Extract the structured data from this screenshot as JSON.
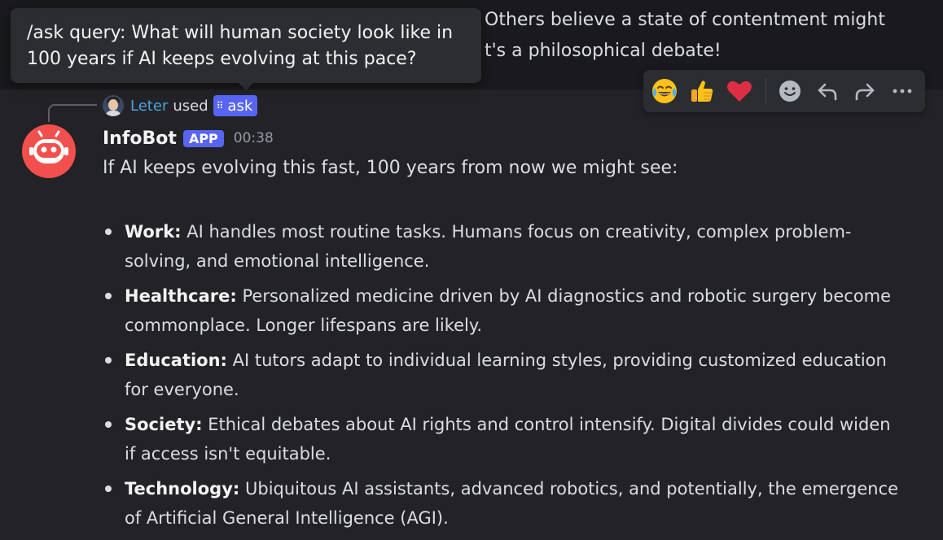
{
  "previous_message": {
    "line1": "Others believe a state of contentment might",
    "line2": "t's a philosophical debate!"
  },
  "tooltip": {
    "text": "/ask query: What will human society look like in 100 years if AI keeps evolving at this pace?"
  },
  "command_usage": {
    "username": "Leter",
    "used_text": "used",
    "command_label": "ask",
    "command_icon": "slash-command-icon"
  },
  "message": {
    "author": "InfoBot",
    "badge": "APP",
    "timestamp": "00:38",
    "intro": "If AI keeps evolving this fast, 100 years from now we might see:",
    "items": [
      {
        "term": "Work:",
        "text": "AI handles most routine tasks. Humans focus on creativity, complex problem-solving, and emotional intelligence."
      },
      {
        "term": "Healthcare:",
        "text": "Personalized medicine driven by AI diagnostics and robotic surgery become commonplace. Longer lifespans are likely."
      },
      {
        "term": "Education:",
        "text": "AI tutors adapt to individual learning styles, providing customized education for everyone."
      },
      {
        "term": "Society:",
        "text": "Ethical debates about AI rights and control intensify. Digital divides could widen if access isn't equitable."
      },
      {
        "term": "Technology:",
        "text": "Ubiquitous AI assistants, advanced robotics, and potentially, the emergence of Artificial General Intelligence (AGI)."
      }
    ]
  },
  "actions": [
    {
      "name": "joy-reaction",
      "glyph": "😂"
    },
    {
      "name": "thumbs-up-reaction",
      "glyph": "👍"
    },
    {
      "name": "heart-reaction",
      "glyph": "❤️"
    }
  ],
  "colors": {
    "background": "#1a1a1e",
    "message_hover": "#232327",
    "accent": "#5865f2",
    "username_link": "#4aa3d8",
    "bot_avatar": "#f2504e",
    "timestamp": "#949ba4"
  }
}
